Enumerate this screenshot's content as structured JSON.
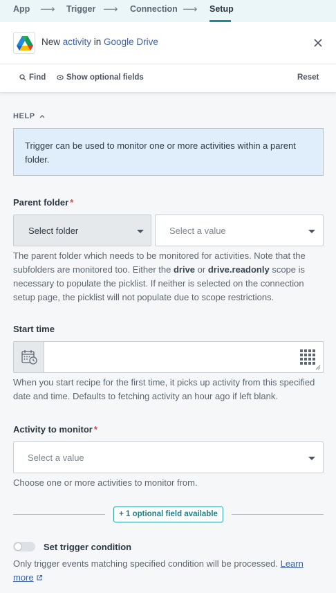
{
  "breadcrumbs": {
    "items": [
      "App",
      "Trigger",
      "Connection",
      "Setup"
    ],
    "active": "Setup"
  },
  "header": {
    "title_prefix": "New ",
    "title_activity": "activity",
    "title_in": " in ",
    "title_app": "Google Drive"
  },
  "toolbar": {
    "find_label": "Find",
    "optional_label": "Show optional fields",
    "reset_label": "Reset"
  },
  "help": {
    "heading": "HELP",
    "text": "Trigger can be used to monitor one or more activities within a parent folder."
  },
  "parent_folder": {
    "label": "Parent folder",
    "required": "*",
    "button_label": "Select folder",
    "select_placeholder": "Select a value",
    "hint_part1": "The parent folder which needs to be monitored for activities. Note that the subfolders are monitored too. Either the ",
    "hint_bold1": "drive",
    "hint_part2": " or ",
    "hint_bold2": "drive.readonly",
    "hint_part3": " scope is necessary to populate the picklist. If neither is selected on the connection setup page, the picklist will not populate due to scope restrictions."
  },
  "start_time": {
    "label": "Start time",
    "value": "",
    "hint": "When you start recipe for the first time, it picks up activity from this specified date and time. Defaults to fetching activity an hour ago if left blank."
  },
  "activity": {
    "label": "Activity to monitor",
    "required": "*",
    "placeholder": "Select a value",
    "hint": "Choose one or more activities to monitor from."
  },
  "optional_fields": {
    "button_label": "1 optional field available"
  },
  "trigger_condition": {
    "label": "Set trigger condition",
    "enabled": false,
    "hint": "Only trigger events matching specified condition will be processed. ",
    "link_label": "Learn more"
  },
  "colors": {
    "accent": "#1e8a92",
    "link": "#3b5fa8",
    "required": "#d5484b",
    "help_bg": "#dfeefa"
  }
}
